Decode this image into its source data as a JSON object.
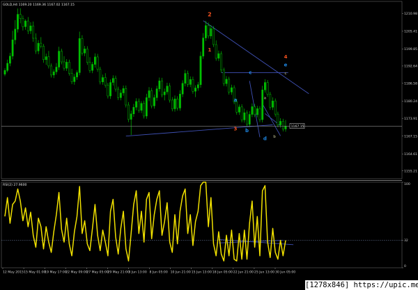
{
  "header": {
    "price_title": "GOLD,H4 1169.20 1169.36 1167.02 1167.15",
    "rsi_title": "RSI(2) 27.9600"
  },
  "watermark": "[1278x846] https://upic.me/",
  "colors": {
    "background": "#000000",
    "candle": "#00c000",
    "trendline": "#3f51b5",
    "rsi": "#f0e000",
    "axis_text": "#cfcfcf",
    "grid": "#5c6b8a",
    "last_price_line": "#8c8c8c",
    "wave_red": "#f4511e",
    "wave_blue": "#1e88e5",
    "wave_grey": "#8d8d6e"
  },
  "chart_data": [
    {
      "type": "candlestick",
      "pane": "price",
      "title": "GOLD,H4 1169.20 1169.36 1167.02 1167.15",
      "y_ticks": [
        1208.1,
        1201.65,
        1195.15,
        1189.0,
        1182.7,
        1176.25,
        1169.95,
        1163.5,
        1157.0,
        1150.85
      ],
      "y_tick_labels": [
        "1210.98",
        "1205.41",
        "1199.85",
        "1192.64",
        "1186.58",
        "1180.24",
        "1173.91",
        "1167.15",
        "1164.61",
        "1155.21"
      ],
      "ylim": [
        1148.0,
        1212.5
      ],
      "last_price": 1167.15,
      "last_price_label": "1167.15",
      "x_tick_labels": [
        "12 May 2015",
        "15 May 01:00",
        "19 May 17:00",
        "22 May 09:00",
        "27 May 05:00",
        "29 May 21:00",
        "3 Jun 13:00",
        "8 Jun 05:00",
        "10 Jun 21:00",
        "15 Jun 13:00",
        "18 Jun 05:00",
        "22 Jun 21:00",
        "25 Jun 13:00",
        "30 Jun 05:00"
      ],
      "candles": [
        {
          "o": 1186.0,
          "h": 1188.2,
          "l": 1185.3,
          "c": 1187.4
        },
        {
          "o": 1187.4,
          "h": 1191.3,
          "l": 1186.7,
          "c": 1190.0
        },
        {
          "o": 1190.0,
          "h": 1193.8,
          "l": 1188.9,
          "c": 1192.6
        },
        {
          "o": 1192.6,
          "h": 1201.8,
          "l": 1191.4,
          "c": 1198.5
        },
        {
          "o": 1198.5,
          "h": 1205.7,
          "l": 1196.9,
          "c": 1202.4
        },
        {
          "o": 1202.4,
          "h": 1209.9,
          "l": 1201.2,
          "c": 1207.8
        },
        {
          "o": 1207.8,
          "h": 1210.0,
          "l": 1204.5,
          "c": 1206.3
        },
        {
          "o": 1206.3,
          "h": 1207.4,
          "l": 1201.9,
          "c": 1203.3
        },
        {
          "o": 1203.3,
          "h": 1206.0,
          "l": 1202.2,
          "c": 1205.4
        },
        {
          "o": 1205.4,
          "h": 1206.8,
          "l": 1200.6,
          "c": 1201.8
        },
        {
          "o": 1201.8,
          "h": 1204.9,
          "l": 1200.7,
          "c": 1203.6
        },
        {
          "o": 1203.6,
          "h": 1205.2,
          "l": 1197.8,
          "c": 1199.1
        },
        {
          "o": 1199.1,
          "h": 1200.9,
          "l": 1193.4,
          "c": 1194.5
        },
        {
          "o": 1194.5,
          "h": 1198.4,
          "l": 1193.3,
          "c": 1197.3
        },
        {
          "o": 1197.3,
          "h": 1199.5,
          "l": 1195.4,
          "c": 1196.2
        },
        {
          "o": 1196.2,
          "h": 1197.0,
          "l": 1190.2,
          "c": 1191.3
        },
        {
          "o": 1191.3,
          "h": 1193.5,
          "l": 1189.4,
          "c": 1192.4
        },
        {
          "o": 1192.4,
          "h": 1194.5,
          "l": 1188.1,
          "c": 1189.0
        },
        {
          "o": 1189.0,
          "h": 1189.9,
          "l": 1184.8,
          "c": 1185.7
        },
        {
          "o": 1185.7,
          "h": 1187.8,
          "l": 1184.6,
          "c": 1186.9
        },
        {
          "o": 1186.9,
          "h": 1190.1,
          "l": 1185.9,
          "c": 1188.6
        },
        {
          "o": 1188.6,
          "h": 1196.0,
          "l": 1187.5,
          "c": 1194.4
        },
        {
          "o": 1194.4,
          "h": 1195.3,
          "l": 1189.6,
          "c": 1190.5
        },
        {
          "o": 1190.5,
          "h": 1192.6,
          "l": 1187.3,
          "c": 1188.2
        },
        {
          "o": 1188.2,
          "h": 1191.5,
          "l": 1187.2,
          "c": 1190.4
        },
        {
          "o": 1190.4,
          "h": 1191.3,
          "l": 1185.5,
          "c": 1186.3
        },
        {
          "o": 1186.3,
          "h": 1188.0,
          "l": 1182.4,
          "c": 1183.3
        },
        {
          "o": 1183.3,
          "h": 1186.1,
          "l": 1182.2,
          "c": 1185.0
        },
        {
          "o": 1185.0,
          "h": 1187.4,
          "l": 1184.0,
          "c": 1186.6
        },
        {
          "o": 1186.6,
          "h": 1201.5,
          "l": 1185.6,
          "c": 1199.0
        },
        {
          "o": 1199.0,
          "h": 1200.2,
          "l": 1192.8,
          "c": 1193.7
        },
        {
          "o": 1193.7,
          "h": 1196.3,
          "l": 1192.6,
          "c": 1195.2
        },
        {
          "o": 1195.2,
          "h": 1196.2,
          "l": 1189.4,
          "c": 1190.3
        },
        {
          "o": 1190.3,
          "h": 1192.2,
          "l": 1186.5,
          "c": 1187.4
        },
        {
          "o": 1187.4,
          "h": 1190.5,
          "l": 1186.4,
          "c": 1189.6
        },
        {
          "o": 1189.6,
          "h": 1193.6,
          "l": 1188.4,
          "c": 1192.3
        },
        {
          "o": 1192.3,
          "h": 1193.4,
          "l": 1186.9,
          "c": 1187.8
        },
        {
          "o": 1187.8,
          "h": 1188.7,
          "l": 1182.3,
          "c": 1183.2
        },
        {
          "o": 1183.2,
          "h": 1185.9,
          "l": 1182.2,
          "c": 1184.8
        },
        {
          "o": 1184.8,
          "h": 1186.4,
          "l": 1181.1,
          "c": 1182.0
        },
        {
          "o": 1182.0,
          "h": 1182.9,
          "l": 1177.2,
          "c": 1178.1
        },
        {
          "o": 1178.1,
          "h": 1184.1,
          "l": 1177.0,
          "c": 1183.0
        },
        {
          "o": 1183.0,
          "h": 1185.6,
          "l": 1181.9,
          "c": 1184.5
        },
        {
          "o": 1184.5,
          "h": 1185.5,
          "l": 1179.7,
          "c": 1180.6
        },
        {
          "o": 1180.6,
          "h": 1181.5,
          "l": 1176.6,
          "c": 1177.5
        },
        {
          "o": 1177.5,
          "h": 1180.4,
          "l": 1176.5,
          "c": 1179.2
        },
        {
          "o": 1179.2,
          "h": 1181.9,
          "l": 1178.2,
          "c": 1180.8
        },
        {
          "o": 1180.8,
          "h": 1181.9,
          "l": 1173.9,
          "c": 1174.8
        },
        {
          "o": 1174.8,
          "h": 1175.9,
          "l": 1168.6,
          "c": 1169.6
        },
        {
          "o": 1169.6,
          "h": 1172.8,
          "l": 1163.9,
          "c": 1171.6
        },
        {
          "o": 1171.6,
          "h": 1175.2,
          "l": 1170.5,
          "c": 1174.0
        },
        {
          "o": 1174.0,
          "h": 1177.3,
          "l": 1172.9,
          "c": 1176.1
        },
        {
          "o": 1176.1,
          "h": 1177.2,
          "l": 1172.0,
          "c": 1172.9
        },
        {
          "o": 1172.9,
          "h": 1176.2,
          "l": 1171.9,
          "c": 1175.4
        },
        {
          "o": 1175.4,
          "h": 1176.4,
          "l": 1169.9,
          "c": 1170.8
        },
        {
          "o": 1170.8,
          "h": 1178.9,
          "l": 1169.8,
          "c": 1177.5
        },
        {
          "o": 1177.5,
          "h": 1181.3,
          "l": 1176.2,
          "c": 1180.0
        },
        {
          "o": 1180.0,
          "h": 1181.0,
          "l": 1173.6,
          "c": 1174.5
        },
        {
          "o": 1174.5,
          "h": 1178.6,
          "l": 1173.5,
          "c": 1177.5
        },
        {
          "o": 1177.5,
          "h": 1181.8,
          "l": 1176.3,
          "c": 1180.7
        },
        {
          "o": 1180.7,
          "h": 1184.8,
          "l": 1179.7,
          "c": 1183.6
        },
        {
          "o": 1183.6,
          "h": 1184.7,
          "l": 1177.6,
          "c": 1178.5
        },
        {
          "o": 1178.5,
          "h": 1180.8,
          "l": 1176.5,
          "c": 1179.6
        },
        {
          "o": 1179.6,
          "h": 1182.9,
          "l": 1178.6,
          "c": 1181.7
        },
        {
          "o": 1181.7,
          "h": 1182.8,
          "l": 1175.7,
          "c": 1176.6
        },
        {
          "o": 1176.6,
          "h": 1177.7,
          "l": 1172.5,
          "c": 1173.4
        },
        {
          "o": 1173.4,
          "h": 1178.3,
          "l": 1172.4,
          "c": 1177.0
        },
        {
          "o": 1177.0,
          "h": 1178.0,
          "l": 1172.8,
          "c": 1173.7
        },
        {
          "o": 1173.7,
          "h": 1180.2,
          "l": 1172.7,
          "c": 1178.8
        },
        {
          "o": 1178.8,
          "h": 1183.8,
          "l": 1177.7,
          "c": 1182.7
        },
        {
          "o": 1182.7,
          "h": 1187.6,
          "l": 1181.6,
          "c": 1186.3
        },
        {
          "o": 1186.3,
          "h": 1187.3,
          "l": 1181.4,
          "c": 1182.3
        },
        {
          "o": 1182.3,
          "h": 1185.2,
          "l": 1181.3,
          "c": 1184.1
        },
        {
          "o": 1184.1,
          "h": 1185.1,
          "l": 1178.9,
          "c": 1179.8
        },
        {
          "o": 1179.8,
          "h": 1182.0,
          "l": 1177.7,
          "c": 1181.0
        },
        {
          "o": 1181.0,
          "h": 1183.2,
          "l": 1180.0,
          "c": 1182.2
        },
        {
          "o": 1182.2,
          "h": 1194.2,
          "l": 1181.1,
          "c": 1192.6
        },
        {
          "o": 1192.6,
          "h": 1201.0,
          "l": 1191.6,
          "c": 1199.2
        },
        {
          "o": 1199.2,
          "h": 1205.4,
          "l": 1198.1,
          "c": 1203.7
        },
        {
          "o": 1203.7,
          "h": 1204.8,
          "l": 1199.0,
          "c": 1199.9
        },
        {
          "o": 1199.9,
          "h": 1203.9,
          "l": 1198.9,
          "c": 1202.6
        },
        {
          "o": 1202.6,
          "h": 1203.5,
          "l": 1195.9,
          "c": 1196.8
        },
        {
          "o": 1196.8,
          "h": 1198.3,
          "l": 1190.9,
          "c": 1191.8
        },
        {
          "o": 1191.8,
          "h": 1194.6,
          "l": 1190.8,
          "c": 1193.5
        },
        {
          "o": 1193.5,
          "h": 1194.4,
          "l": 1186.6,
          "c": 1187.5
        },
        {
          "o": 1187.5,
          "h": 1188.4,
          "l": 1181.7,
          "c": 1182.6
        },
        {
          "o": 1182.6,
          "h": 1185.3,
          "l": 1181.6,
          "c": 1184.2
        },
        {
          "o": 1184.2,
          "h": 1185.1,
          "l": 1178.6,
          "c": 1179.5
        },
        {
          "o": 1179.5,
          "h": 1182.2,
          "l": 1178.5,
          "c": 1181.1
        },
        {
          "o": 1181.1,
          "h": 1182.0,
          "l": 1175.1,
          "c": 1176.0
        },
        {
          "o": 1176.0,
          "h": 1177.0,
          "l": 1171.3,
          "c": 1172.2
        },
        {
          "o": 1172.2,
          "h": 1175.0,
          "l": 1171.2,
          "c": 1174.1
        },
        {
          "o": 1174.1,
          "h": 1175.1,
          "l": 1168.5,
          "c": 1169.4
        },
        {
          "o": 1169.4,
          "h": 1173.5,
          "l": 1168.4,
          "c": 1172.0
        },
        {
          "o": 1172.0,
          "h": 1172.9,
          "l": 1166.9,
          "c": 1167.8
        },
        {
          "o": 1167.8,
          "h": 1172.6,
          "l": 1166.8,
          "c": 1171.4
        },
        {
          "o": 1171.4,
          "h": 1175.4,
          "l": 1170.4,
          "c": 1174.2
        },
        {
          "o": 1174.2,
          "h": 1175.2,
          "l": 1170.4,
          "c": 1171.3
        },
        {
          "o": 1171.3,
          "h": 1174.5,
          "l": 1170.3,
          "c": 1173.5
        },
        {
          "o": 1173.5,
          "h": 1174.4,
          "l": 1168.6,
          "c": 1169.5
        },
        {
          "o": 1169.5,
          "h": 1181.8,
          "l": 1168.5,
          "c": 1180.3
        },
        {
          "o": 1180.3,
          "h": 1184.2,
          "l": 1179.3,
          "c": 1183.0
        },
        {
          "o": 1183.0,
          "h": 1183.9,
          "l": 1177.8,
          "c": 1178.7
        },
        {
          "o": 1178.7,
          "h": 1179.6,
          "l": 1173.1,
          "c": 1174.0
        },
        {
          "o": 1174.0,
          "h": 1177.6,
          "l": 1173.0,
          "c": 1176.3
        },
        {
          "o": 1176.3,
          "h": 1177.2,
          "l": 1170.6,
          "c": 1171.5
        },
        {
          "o": 1171.5,
          "h": 1172.4,
          "l": 1166.7,
          "c": 1167.6
        },
        {
          "o": 1167.6,
          "h": 1170.0,
          "l": 1166.6,
          "c": 1168.9
        },
        {
          "o": 1168.9,
          "h": 1169.8,
          "l": 1165.2,
          "c": 1166.1
        },
        {
          "o": 1166.1,
          "h": 1169.36,
          "l": 1165.1,
          "c": 1167.15
        }
      ],
      "trendlines": [
        {
          "from": {
            "i": 47,
            "p": 1163.5
          },
          "to": {
            "i": 104,
            "p": 1167.6
          }
        },
        {
          "from": {
            "i": 77,
            "p": 1205.5
          },
          "to": {
            "i": 118,
            "p": 1178.9
          }
        },
        {
          "from": {
            "i": 84,
            "p": 1186.6
          },
          "to": {
            "i": 110,
            "p": 1186.6
          }
        },
        {
          "from": {
            "i": 95,
            "p": 1183.6
          },
          "to": {
            "i": 99,
            "p": 1163.1
          }
        },
        {
          "from": {
            "i": 100,
            "p": 1175.2
          },
          "to": {
            "i": 107,
            "p": 1163.6
          }
        },
        {
          "from": {
            "i": 101,
            "p": 1171.7
          },
          "to": {
            "i": 107,
            "p": 1167.3
          }
        }
      ],
      "wave_labels": [
        {
          "text": "2",
          "i": 79.5,
          "p": 1207.0,
          "color": "red",
          "size": 8
        },
        {
          "text": "1",
          "i": 79.5,
          "p": 1194.3,
          "color": "red",
          "size": 7
        },
        {
          "text": "3",
          "i": 89.5,
          "p": 1165.6,
          "color": "red",
          "size": 7
        },
        {
          "text": "4",
          "i": 109.0,
          "p": 1191.7,
          "color": "red",
          "size": 7
        },
        {
          "text": "e",
          "i": 109.0,
          "p": 1188.8,
          "color": "blue",
          "size": 7
        },
        {
          "text": "c",
          "i": 109.0,
          "p": 1185.9,
          "color": "grey",
          "size": 5
        },
        {
          "text": "c",
          "i": 95.3,
          "p": 1186.1,
          "color": "blue",
          "size": 7
        },
        {
          "text": "a",
          "i": 89.5,
          "p": 1176.1,
          "color": "blue",
          "size": 7
        },
        {
          "text": "b",
          "i": 94.0,
          "p": 1164.9,
          "color": "blue",
          "size": 7
        },
        {
          "text": "d",
          "i": 101.0,
          "p": 1162.1,
          "color": "blue",
          "size": 7
        },
        {
          "text": "a",
          "i": 101.0,
          "p": 1176.9,
          "color": "grey",
          "size": 5
        },
        {
          "text": "b",
          "i": 104.7,
          "p": 1162.9,
          "color": "grey",
          "size": 5
        }
      ]
    },
    {
      "type": "line",
      "pane": "rsi",
      "title": "RSI(2) 27.9600",
      "y_ticks": [
        100,
        32,
        0
      ],
      "y_tick_labels": [
        "100",
        "32",
        "0"
      ],
      "ylim": [
        0,
        100
      ],
      "level": 32,
      "values": [
        60,
        82,
        52,
        74,
        78,
        92,
        78,
        55,
        70,
        48,
        65,
        38,
        24,
        58,
        48,
        22,
        48,
        30,
        18,
        42,
        62,
        88,
        45,
        30,
        58,
        28,
        14,
        42,
        60,
        95,
        40,
        55,
        28,
        20,
        46,
        74,
        38,
        20,
        44,
        30,
        14,
        66,
        80,
        36,
        16,
        46,
        66,
        22,
        8,
        40,
        74,
        90,
        40,
        66,
        30,
        80,
        88,
        34,
        62,
        80,
        90,
        38,
        54,
        76,
        30,
        18,
        62,
        28,
        66,
        84,
        92,
        40,
        62,
        26,
        54,
        66,
        96,
        100,
        100,
        48,
        82,
        28,
        14,
        42,
        16,
        8,
        38,
        14,
        44,
        10,
        8,
        40,
        10,
        44,
        10,
        52,
        78,
        24,
        60,
        14,
        90,
        96,
        30,
        12,
        46,
        18,
        10,
        32,
        14,
        32
      ],
      "trendlines": [
        {
          "from": {
            "i": 83,
            "v": 33
          },
          "to": {
            "i": 112,
            "v": 27
          }
        },
        {
          "from": {
            "i": 83,
            "v": 29
          },
          "to": {
            "i": 108,
            "v": 32
          }
        }
      ]
    }
  ]
}
